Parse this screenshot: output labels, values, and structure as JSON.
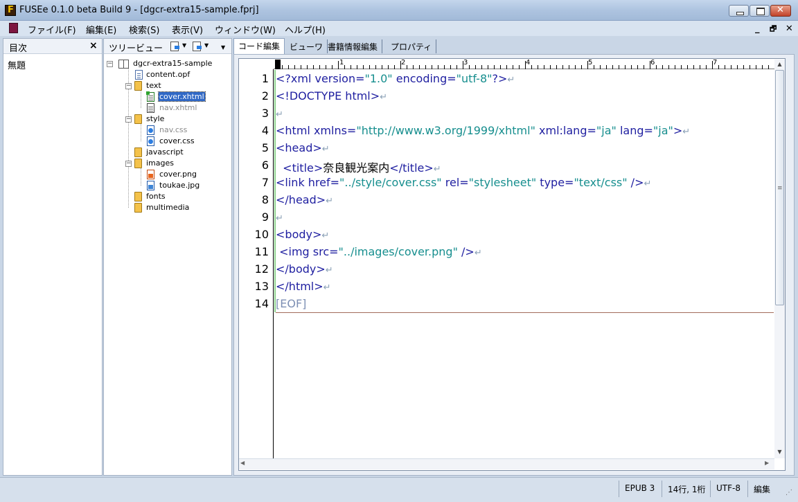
{
  "window": {
    "title": "FUSEe 0.1.0 beta Build 9 - [dgcr-extra15-sample.fprj]"
  },
  "menu": {
    "items": [
      "ファイル(F)",
      "編集(E)",
      "検索(S)",
      "表示(V)",
      "ウィンドウ(W)",
      "ヘルプ(H)"
    ],
    "mdi_controls": "_  🗗  ✕"
  },
  "toc_panel": {
    "title": "目次",
    "close": "×",
    "items": [
      "無題"
    ]
  },
  "tree_panel": {
    "title": "ツリービュー",
    "nodes": [
      {
        "label": "dgcr-extra15-sample",
        "type": "book"
      },
      {
        "label": "content.opf",
        "type": "file"
      },
      {
        "label": "text",
        "type": "folder"
      },
      {
        "label": "cover.xhtml",
        "type": "xhtml",
        "selected": true
      },
      {
        "label": "nav.xhtml",
        "type": "xhtml",
        "dimmed": true
      },
      {
        "label": "style",
        "type": "folder"
      },
      {
        "label": "nav.css",
        "type": "css",
        "dimmed": true
      },
      {
        "label": "cover.css",
        "type": "css"
      },
      {
        "label": "javascript",
        "type": "folder"
      },
      {
        "label": "images",
        "type": "folder"
      },
      {
        "label": "cover.png",
        "type": "png"
      },
      {
        "label": "toukae.jpg",
        "type": "jpg"
      },
      {
        "label": "fonts",
        "type": "folder"
      },
      {
        "label": "multimedia",
        "type": "folder"
      }
    ]
  },
  "tabs": [
    "コード編集",
    "ビューワ",
    "書籍情報編集",
    "プロパティ"
  ],
  "ruler": {
    "labels": [
      "1",
      "2",
      "3",
      "4",
      "5",
      "6",
      "7"
    ]
  },
  "editor": {
    "line_numbers": [
      "1",
      "2",
      "3",
      "4",
      "5",
      "6",
      "7",
      "8",
      "9",
      "10",
      "11",
      "12",
      "13",
      "14"
    ],
    "lines": [
      [
        {
          "t": "tag",
          "s": "<?xml version="
        },
        {
          "t": "str",
          "s": "\"1.0\""
        },
        {
          "t": "tag",
          "s": " encoding="
        },
        {
          "t": "str",
          "s": "\"utf-8\""
        },
        {
          "t": "tag",
          "s": "?>"
        },
        {
          "t": "nl",
          "s": "↵"
        }
      ],
      [
        {
          "t": "tag",
          "s": "<!DOCTYPE html>"
        },
        {
          "t": "nl",
          "s": "↵"
        }
      ],
      [
        {
          "t": "nl",
          "s": "↵"
        }
      ],
      [
        {
          "t": "tag",
          "s": "<html xmlns="
        },
        {
          "t": "str",
          "s": "\"http://www.w3.org/1999/xhtml\""
        },
        {
          "t": "tag",
          "s": " xml:lang="
        },
        {
          "t": "str",
          "s": "\"ja\""
        },
        {
          "t": "tag",
          "s": " lang="
        },
        {
          "t": "str",
          "s": "\"ja\""
        },
        {
          "t": "tag",
          "s": ">"
        },
        {
          "t": "nl",
          "s": "↵"
        }
      ],
      [
        {
          "t": "tag",
          "s": "<head>"
        },
        {
          "t": "nl",
          "s": "↵"
        }
      ],
      [
        {
          "t": "tag",
          "s": "  <title>"
        },
        {
          "t": "txt",
          "s": "奈良観光案内"
        },
        {
          "t": "tag",
          "s": "</title>"
        },
        {
          "t": "nl",
          "s": "↵"
        }
      ],
      [
        {
          "t": "tag",
          "s": "<link href="
        },
        {
          "t": "str",
          "s": "\"../style/cover.css\""
        },
        {
          "t": "tag",
          "s": " rel="
        },
        {
          "t": "str",
          "s": "\"stylesheet\""
        },
        {
          "t": "tag",
          "s": " type="
        },
        {
          "t": "str",
          "s": "\"text/css\""
        },
        {
          "t": "tag",
          "s": " />"
        },
        {
          "t": "nl",
          "s": "↵"
        }
      ],
      [
        {
          "t": "tag",
          "s": "</head>"
        },
        {
          "t": "nl",
          "s": "↵"
        }
      ],
      [
        {
          "t": "nl",
          "s": "↵"
        }
      ],
      [
        {
          "t": "tag",
          "s": "<body>"
        },
        {
          "t": "nl",
          "s": "↵"
        }
      ],
      [
        {
          "t": "tag",
          "s": " <img src="
        },
        {
          "t": "str",
          "s": "\"../images/cover.png\""
        },
        {
          "t": "tag",
          "s": " />"
        },
        {
          "t": "nl",
          "s": "↵"
        }
      ],
      [
        {
          "t": "tag",
          "s": "</body>"
        },
        {
          "t": "nl",
          "s": "↵"
        }
      ],
      [
        {
          "t": "tag",
          "s": "</html>"
        },
        {
          "t": "nl",
          "s": "↵"
        }
      ],
      [
        {
          "t": "eof",
          "s": "[EOF]"
        }
      ]
    ]
  },
  "status": {
    "format": "EPUB 3",
    "position": "14行, 1桁",
    "encoding": "UTF-8",
    "mode": "編集"
  },
  "colors": {
    "tag": "#1e1ea0",
    "string": "#168e8e",
    "selection": "#3169c6"
  }
}
